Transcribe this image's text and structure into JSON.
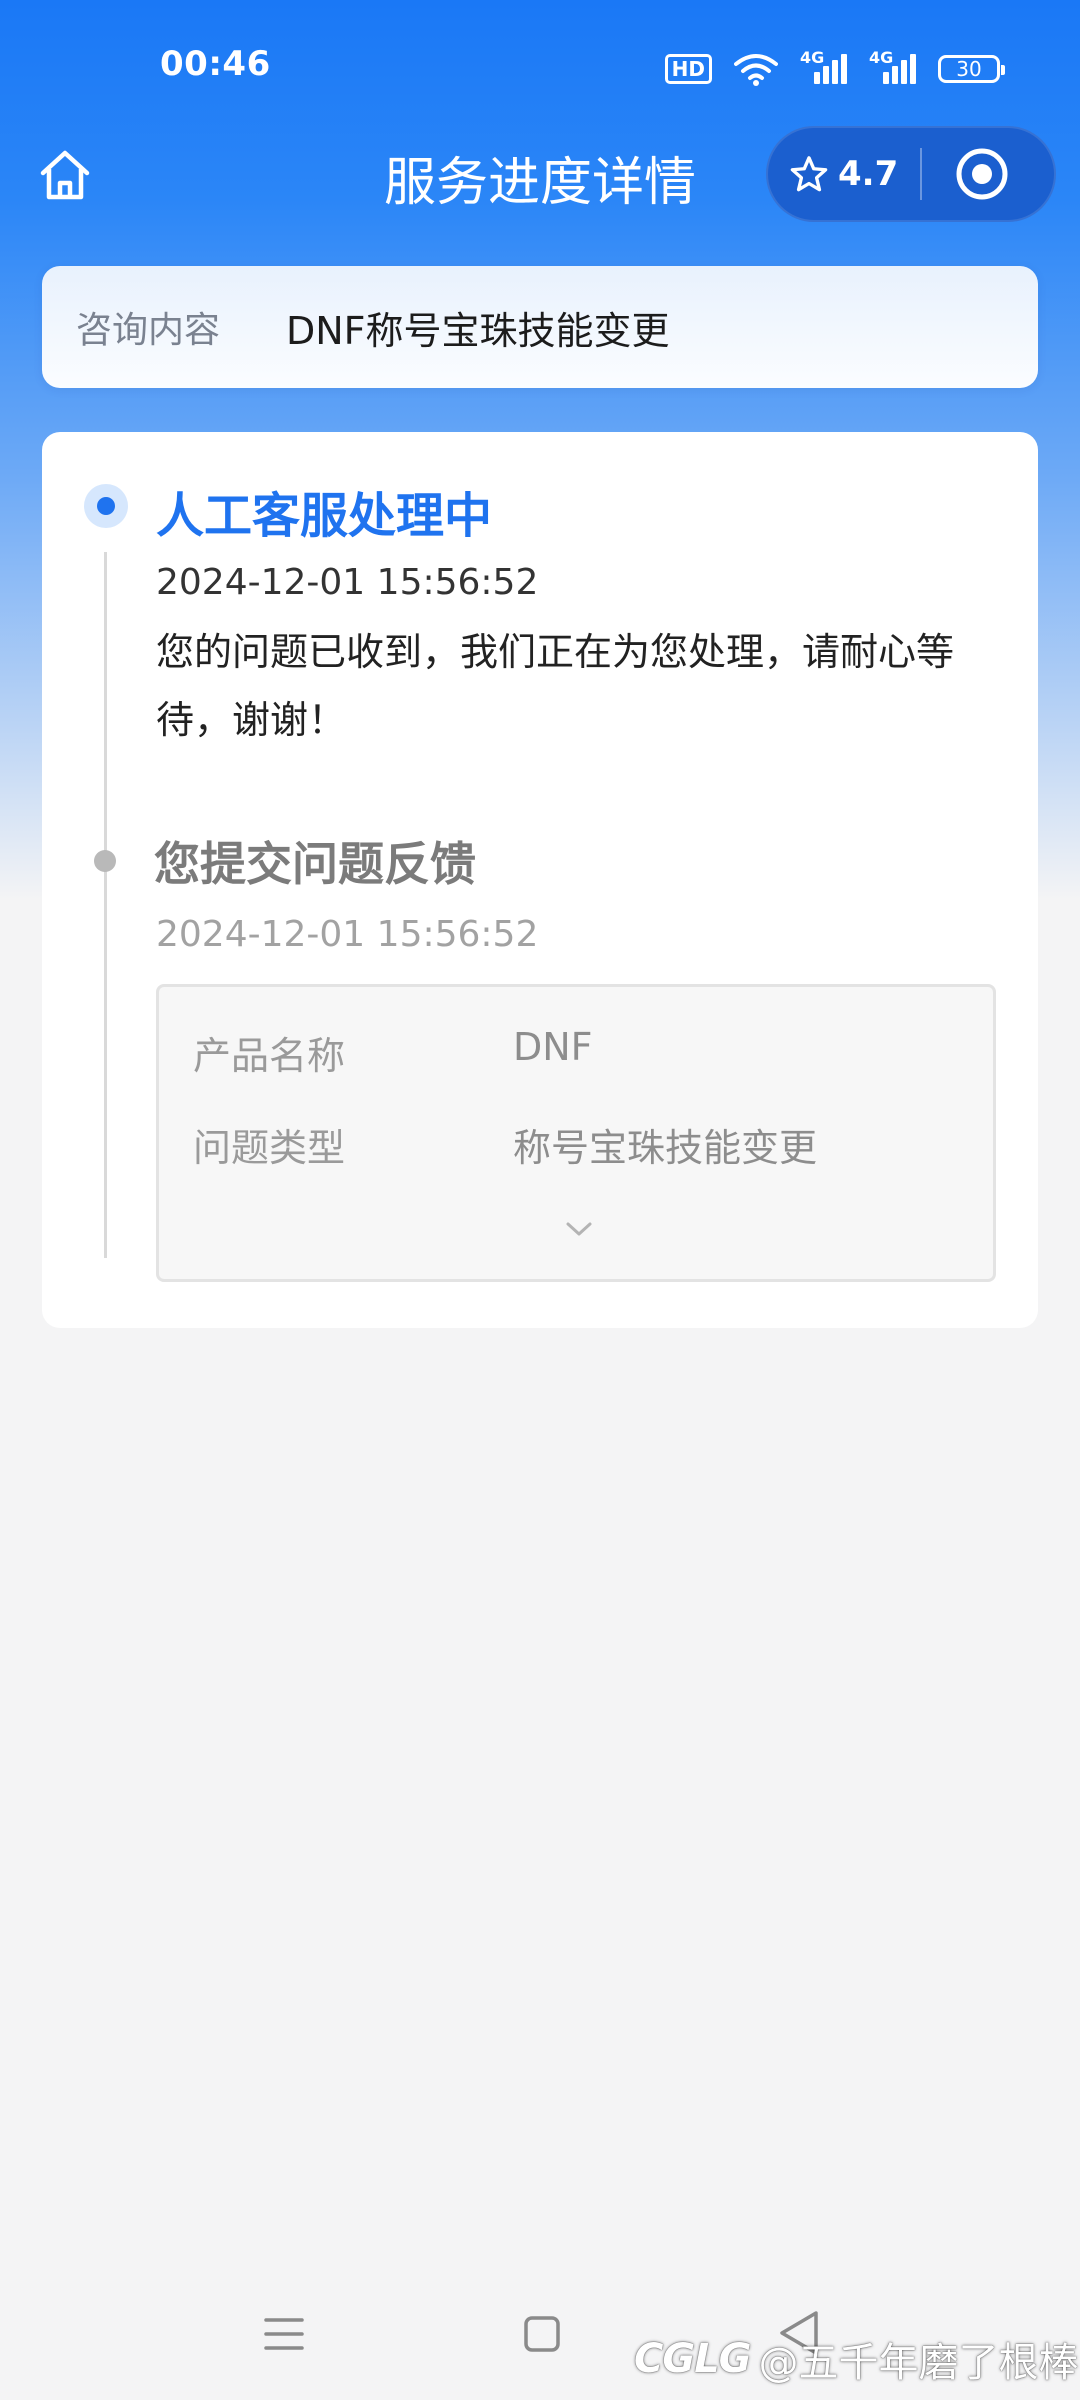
{
  "status_bar": {
    "time": "00:46",
    "hd_label": "HD",
    "signal_label_1": "4G",
    "signal_label_2": "4G",
    "battery": "30"
  },
  "header": {
    "title": "服务进度详情",
    "rating": "4.7"
  },
  "consult": {
    "label": "咨询内容",
    "value": "DNF称号宝珠技能变更"
  },
  "timeline": [
    {
      "title": "人工客服处理中",
      "time": "2024-12-01 15:56:52",
      "message": "您的问题已收到，我们正在为您处理，请耐心等待，谢谢！"
    },
    {
      "title": "您提交问题反馈",
      "time": "2024-12-01 15:56:52",
      "details": [
        {
          "label": "产品名称",
          "value": "DNF"
        },
        {
          "label": "问题类型",
          "value": "称号宝珠技能变更"
        }
      ]
    }
  ],
  "watermark": {
    "logo": "CGLG",
    "text": "@五千年磨了根棒"
  },
  "colors": {
    "primary": "#1f73ef",
    "header_bg": "#1a78f6",
    "capsule_bg": "#1b5fcf",
    "page_bg": "#f4f4f5"
  }
}
